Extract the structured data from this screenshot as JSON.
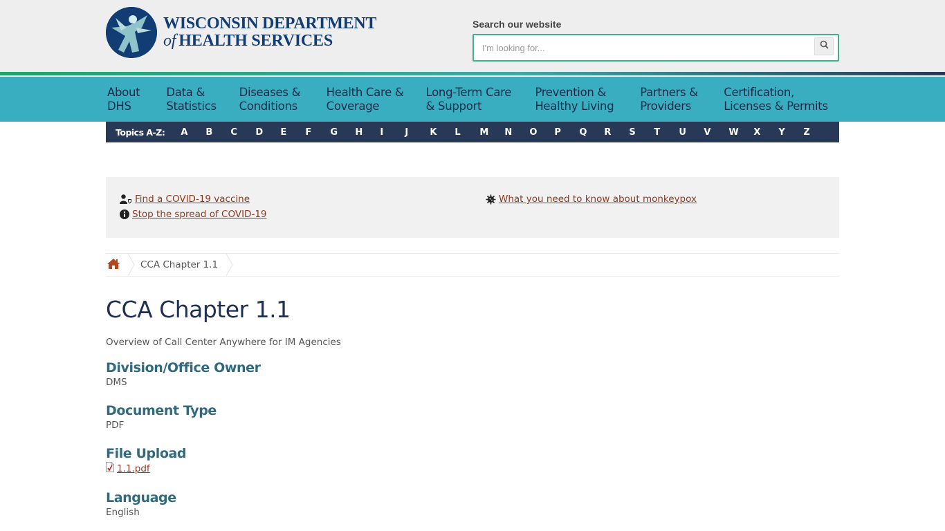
{
  "header": {
    "logo_line1": "WISCONSIN DEPARTMENT",
    "logo_of": "of",
    "logo_line2": "HEALTH SERVICES",
    "search_label": "Search our website",
    "search_placeholder": "I'm looking for...",
    "search_value": "",
    "search_icon": "magnifier-icon"
  },
  "colors": {
    "nav_bg": "#3aaec1",
    "az_bg": "#273956",
    "link": "#8b3a1f",
    "heading": "#2f6a7e",
    "title": "#1f3050",
    "search_border": "#41b08a"
  },
  "nav": {
    "items": [
      {
        "line1": "About",
        "line2": "DHS"
      },
      {
        "line1": "Data &",
        "line2": "Statistics"
      },
      {
        "line1": "Diseases &",
        "line2": "Conditions"
      },
      {
        "line1": "Health Care &",
        "line2": "Coverage"
      },
      {
        "line1": "Long-Term Care",
        "line2": "& Support"
      },
      {
        "line1": "Prevention &",
        "line2": "Healthy Living"
      },
      {
        "line1": "Partners &",
        "line2": "Providers"
      },
      {
        "line1": "Certification,",
        "line2": "Licenses & Permits"
      }
    ]
  },
  "az": {
    "label": "Topics A-Z:",
    "letters": [
      "A",
      "B",
      "C",
      "D",
      "E",
      "F",
      "G",
      "H",
      "I",
      "J",
      "K",
      "L",
      "M",
      "N",
      "O",
      "P",
      "Q",
      "R",
      "S",
      "T",
      "U",
      "V",
      "W",
      "X",
      "Y",
      "Z"
    ]
  },
  "alerts": {
    "vaccine": {
      "icon": "user-shield-icon",
      "text": "Find a COVID-19 vaccine"
    },
    "spread": {
      "icon": "info-circle-icon",
      "text": "Stop the spread of COVID-19"
    },
    "monkeypox": {
      "icon": "virus-icon",
      "text": "What you need to know about monkeypox"
    }
  },
  "breadcrumb": {
    "home_icon": "home-icon",
    "current": "CCA Chapter 1.1"
  },
  "page": {
    "title": "CCA Chapter 1.1",
    "summary": "Overview of Call Center Anywhere for IM Agencies",
    "fields": {
      "division": {
        "label": "Division/Office Owner",
        "value": "DMS"
      },
      "doc_type": {
        "label": "Document Type",
        "value": "PDF"
      },
      "file": {
        "label": "File Upload",
        "value": "1.1.pdf",
        "icon": "pdf-file-icon"
      },
      "language": {
        "label": "Language",
        "value": "English"
      }
    }
  }
}
